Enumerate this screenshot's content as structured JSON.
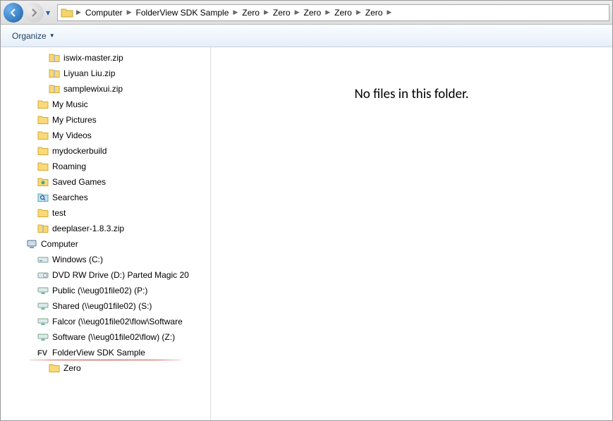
{
  "breadcrumb": [
    "Computer",
    "FolderView SDK Sample",
    "Zero",
    "Zero",
    "Zero",
    "Zero",
    "Zero"
  ],
  "toolbar": {
    "organize": "Organize"
  },
  "main": {
    "empty": "No files in this folder."
  },
  "tree": [
    {
      "label": "iswix-master.zip",
      "icon": "zip",
      "indent": 68
    },
    {
      "label": "Liyuan Liu.zip",
      "icon": "zip",
      "indent": 68
    },
    {
      "label": "samplewixui.zip",
      "icon": "zip",
      "indent": 68
    },
    {
      "label": "My Music",
      "icon": "folder",
      "indent": 52
    },
    {
      "label": "My Pictures",
      "icon": "folder",
      "indent": 52
    },
    {
      "label": "My Videos",
      "icon": "folder",
      "indent": 52
    },
    {
      "label": "mydockerbuild",
      "icon": "folder",
      "indent": 52
    },
    {
      "label": "Roaming",
      "icon": "folder",
      "indent": 52
    },
    {
      "label": "Saved Games",
      "icon": "folder-games",
      "indent": 52
    },
    {
      "label": "Searches",
      "icon": "search-folder",
      "indent": 52
    },
    {
      "label": "test",
      "icon": "folder",
      "indent": 52
    },
    {
      "label": "deeplaser-1.8.3.zip",
      "icon": "zip",
      "indent": 52
    },
    {
      "label": "Computer",
      "icon": "computer",
      "indent": 36
    },
    {
      "label": "Windows (C:)",
      "icon": "drive",
      "indent": 52
    },
    {
      "label": "DVD RW Drive (D:) Parted Magic 20",
      "icon": "disc",
      "indent": 52
    },
    {
      "label": "Public (\\\\eug01file02) (P:)",
      "icon": "netdrive",
      "indent": 52
    },
    {
      "label": "Shared (\\\\eug01file02) (S:)",
      "icon": "netdrive",
      "indent": 52
    },
    {
      "label": "Falcor (\\\\eug01file02\\flow\\Software",
      "icon": "netdrive",
      "indent": 52
    },
    {
      "label": "Software (\\\\eug01file02\\flow) (Z:)",
      "icon": "netdrive",
      "indent": 52
    },
    {
      "label": "FolderView SDK Sample",
      "icon": "fv",
      "indent": 52,
      "underline": true
    },
    {
      "label": "Zero",
      "icon": "folder",
      "indent": 68
    }
  ]
}
